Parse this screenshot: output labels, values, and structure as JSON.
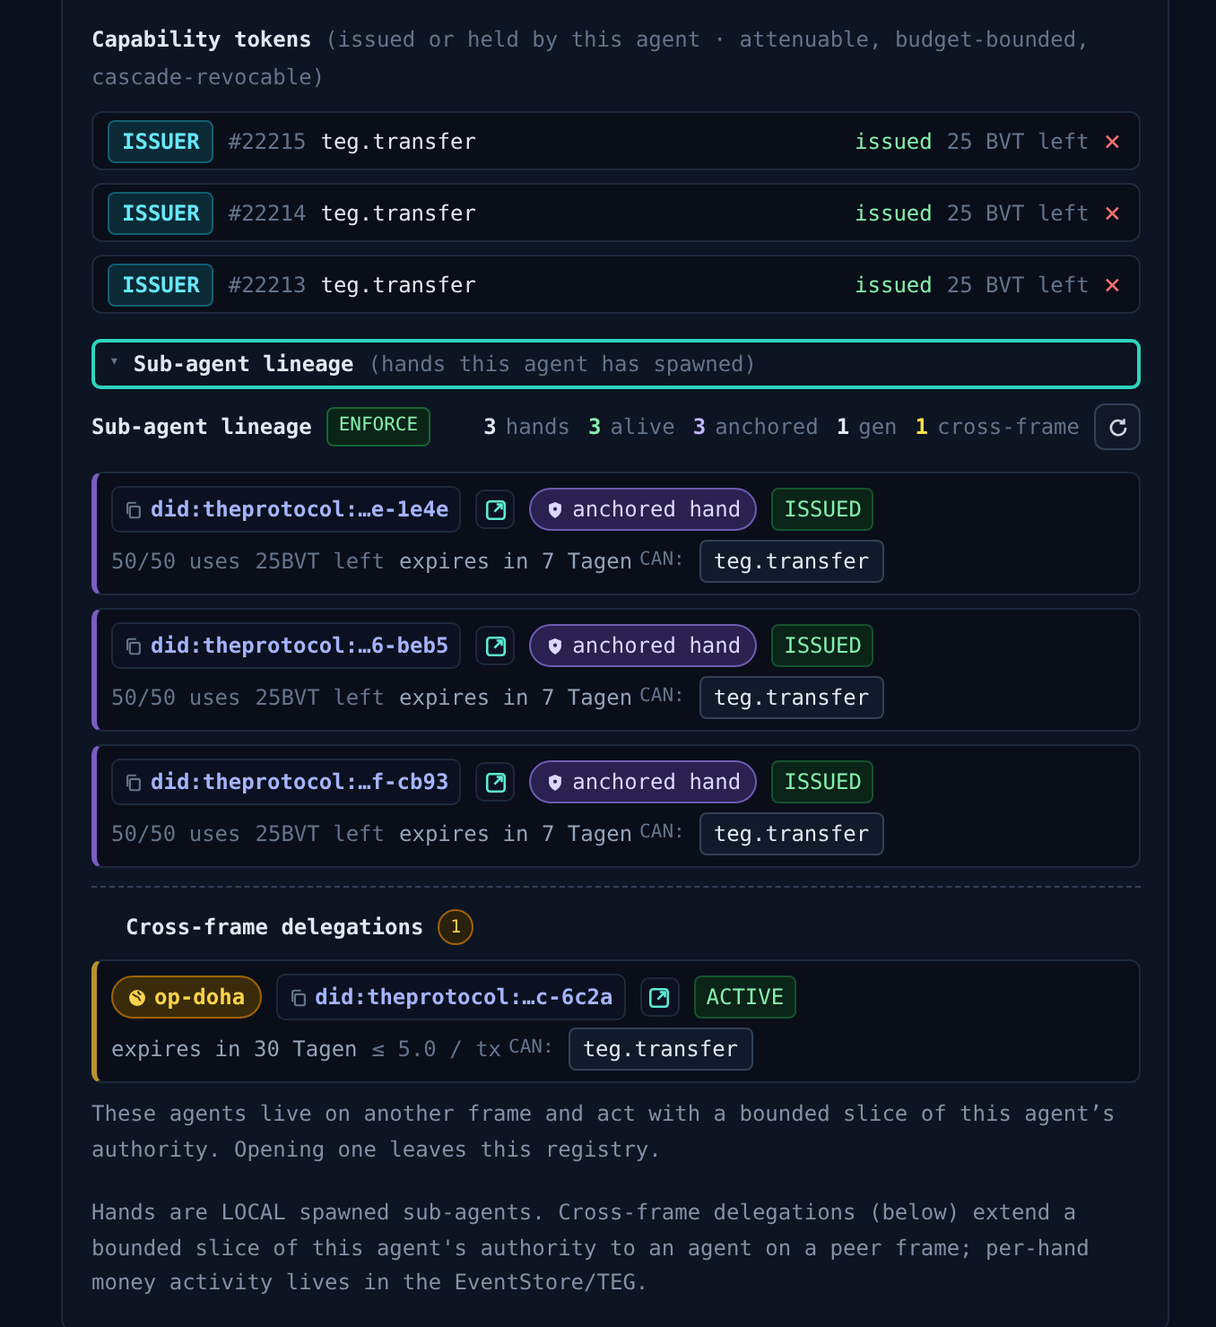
{
  "capability_tokens": {
    "title": "Capability tokens",
    "note": "(issued or held by this agent · attenuable, budget-bounded, cascade-revocable)",
    "tokens": [
      {
        "role": "ISSUER",
        "id": "#22215",
        "scope": "teg.transfer",
        "status": "issued",
        "budget": "25 BVT left",
        "revoke": "×"
      },
      {
        "role": "ISSUER",
        "id": "#22214",
        "scope": "teg.transfer",
        "status": "issued",
        "budget": "25 BVT left",
        "revoke": "×"
      },
      {
        "role": "ISSUER",
        "id": "#22213",
        "scope": "teg.transfer",
        "status": "issued",
        "budget": "25 BVT left",
        "revoke": "×"
      }
    ]
  },
  "lineage": {
    "toggle": {
      "arrow": "▾",
      "title": "Sub-agent lineage",
      "note": "(hands this agent has spawned)",
      "expanded": true
    },
    "heading": "Sub-agent lineage",
    "mode": "ENFORCE",
    "stats": [
      {
        "count": "3",
        "label": "hands",
        "color": "#e2e8f0"
      },
      {
        "count": "3",
        "label": "alive",
        "color": "#86efac"
      },
      {
        "count": "3",
        "label": "anchored",
        "color": "#c4b5fd"
      },
      {
        "count": "1",
        "label": "gen",
        "color": "#e2e8f0"
      },
      {
        "count": "1",
        "label": "cross-frame",
        "color": "#fde047"
      }
    ],
    "hands": [
      {
        "did": "did:theprotocol:…e-1e4e",
        "tag": "anchored hand",
        "status": "ISSUED",
        "uses": "50/50 uses",
        "budget": "25BVT left",
        "expiry": "expires in 7 Tagen",
        "can_label": "CAN:",
        "capability": "teg.transfer"
      },
      {
        "did": "did:theprotocol:…6-beb5",
        "tag": "anchored hand",
        "status": "ISSUED",
        "uses": "50/50 uses",
        "budget": "25BVT left",
        "expiry": "expires in 7 Tagen",
        "can_label": "CAN:",
        "capability": "teg.transfer"
      },
      {
        "did": "did:theprotocol:…f-cb93",
        "tag": "anchored hand",
        "status": "ISSUED",
        "uses": "50/50 uses",
        "budget": "25BVT left",
        "expiry": "expires in 7 Tagen",
        "can_label": "CAN:",
        "capability": "teg.transfer"
      }
    ]
  },
  "cross_frame": {
    "title": "Cross-frame delegations",
    "count": "1",
    "delegations": [
      {
        "frame": "op-doha",
        "did": "did:theprotocol:…c-6c2a",
        "status": "ACTIVE",
        "expiry": "expires in 30 Tagen",
        "limit": "≤ 5.0 / tx",
        "can_label": "CAN:",
        "capability": "teg.transfer"
      }
    ],
    "note": "These agents live on another frame and act with a bounded slice of this agent’s authority. Opening one leaves this registry."
  },
  "footnote": "Hands are LOCAL spawned sub-agents. Cross-frame delegations (below) extend a bounded slice of this agent's authority to an agent on a peer frame; per-hand money activity lives in the EventStore/TEG."
}
